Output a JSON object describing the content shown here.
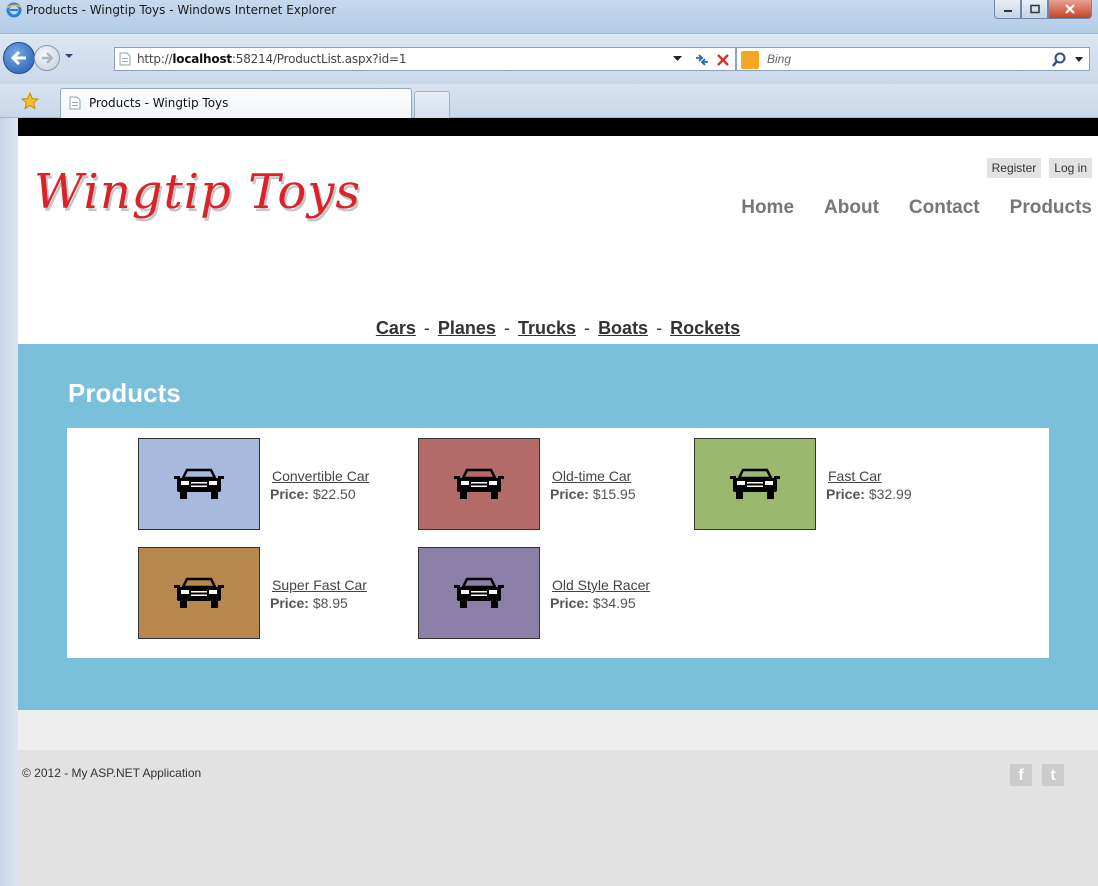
{
  "window": {
    "title": "Products - Wingtip Toys - Windows Internet Explorer"
  },
  "addressbar": {
    "url_prefix": "http://",
    "url_host": "localhost",
    "url_rest": ":58214/ProductList.aspx?id=1",
    "search_engine": "Bing"
  },
  "tabs": [
    {
      "label": "Products - Wingtip Toys"
    }
  ],
  "site": {
    "logo": "Wingtip Toys",
    "login_links": {
      "register": "Register",
      "login": "Log in"
    },
    "nav": [
      "Home",
      "About",
      "Contact",
      "Products"
    ],
    "categories": [
      "Cars",
      "Planes",
      "Trucks",
      "Boats",
      "Rockets"
    ],
    "category_separator": "-",
    "section_title": "Products",
    "price_label": "Price:",
    "products": [
      {
        "name": "Convertible Car",
        "price": "$22.50",
        "color": "#a7b9dd"
      },
      {
        "name": "Old-time Car",
        "price": "$15.95",
        "color": "#b26b69"
      },
      {
        "name": "Fast Car",
        "price": "$32.99",
        "color": "#9bb86f"
      },
      {
        "name": "Super Fast Car",
        "price": "$8.95",
        "color": "#b8874e"
      },
      {
        "name": "Old Style Racer",
        "price": "$34.95",
        "color": "#8d80a8"
      }
    ],
    "footer": {
      "copyright": "© 2012 - My ASP.NET Application",
      "social_facebook": "f",
      "social_twitter": "t"
    }
  },
  "colors": {
    "featured_bg": "#7ac0da",
    "logo_red": "#d8232a"
  }
}
